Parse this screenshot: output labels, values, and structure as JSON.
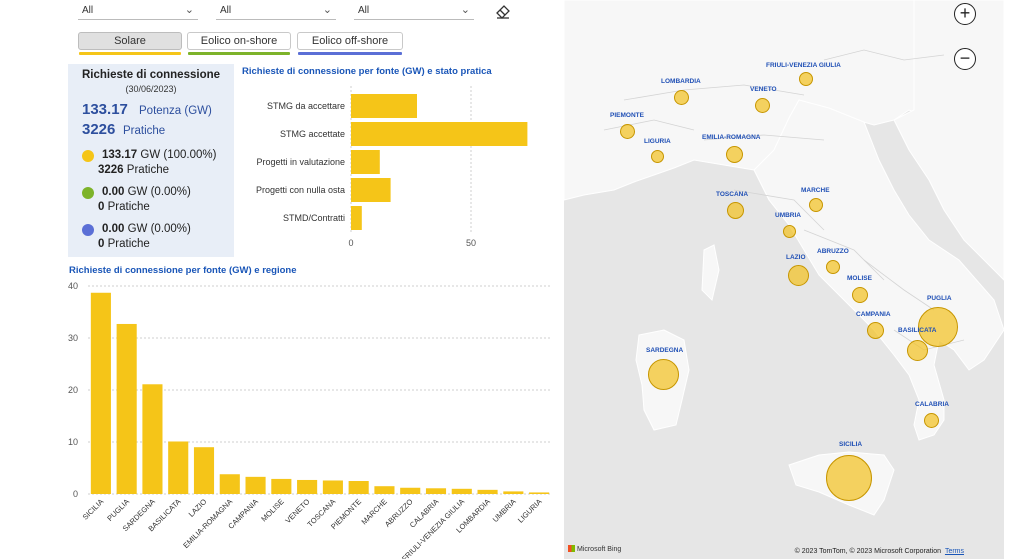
{
  "filters": [
    {
      "value": "All"
    },
    {
      "value": "All"
    },
    {
      "value": "All"
    }
  ],
  "toggles": [
    {
      "label": "Solare",
      "active": true,
      "color": "#f5c518"
    },
    {
      "label": "Eolico on-shore",
      "active": false,
      "color": "#7db32a"
    },
    {
      "label": "Eolico off-shore",
      "active": false,
      "color": "#5b6fd6"
    }
  ],
  "summary": {
    "title": "Richieste di connessione",
    "date": "(30/06/2023)",
    "total_power": "133.17",
    "total_power_label": "Potenza (GW)",
    "total_count": "3226",
    "total_count_label": "Pratiche",
    "sources": [
      {
        "color": "#f5c518",
        "gw": "133.17",
        "gw_label": "GW (100.00%)",
        "count": "3226",
        "count_label": "Pratiche"
      },
      {
        "color": "#7db32a",
        "gw": "0.00",
        "gw_label": "GW (0.00%)",
        "count": "0",
        "count_label": "Pratiche"
      },
      {
        "color": "#5b6fd6",
        "gw": "0.00",
        "gw_label": "GW (0.00%)",
        "count": "0",
        "count_label": "Pratiche"
      }
    ]
  },
  "chart_data": [
    {
      "type": "bar",
      "orientation": "horizontal",
      "title": "Richieste di connessione per fonte (GW) e stato pratica",
      "categories": [
        "STMG da accettare",
        "STMG accettate",
        "Progetti in valutazione",
        "Progetti con nulla osta",
        "STMD/Contratti"
      ],
      "values": [
        27.5,
        73.5,
        12,
        16.5,
        4.5
      ],
      "xticks": [
        0,
        50
      ],
      "xlim": [
        0,
        75
      ],
      "color": "#f5c518",
      "grid": true
    },
    {
      "type": "bar",
      "orientation": "vertical",
      "title": "Richieste di connessione per fonte (GW) e regione",
      "categories": [
        "SICILIA",
        "PUGLIA",
        "SARDEGNA",
        "BASILICATA",
        "LAZIO",
        "EMILIA-ROMAGNA",
        "CAMPANIA",
        "MOLISE",
        "VENETO",
        "TOSCANA",
        "PIEMONTE",
        "MARCHE",
        "ABRUZZO",
        "CALABRIA",
        "FRIULI-VENEZIA GIULIA",
        "LOMBARDIA",
        "UMBRIA",
        "LIGURIA"
      ],
      "values": [
        38.7,
        32.7,
        21.1,
        10.1,
        9.0,
        3.8,
        3.3,
        2.9,
        2.7,
        2.6,
        2.5,
        1.5,
        1.2,
        1.1,
        1.0,
        0.8,
        0.5,
        0.3
      ],
      "yticks": [
        0,
        10,
        20,
        30,
        40
      ],
      "ylim": [
        0,
        40
      ],
      "color": "#f5c518",
      "grid": true
    }
  ],
  "map": {
    "zoom_in": "+",
    "zoom_out": "−",
    "regions": [
      {
        "name": "FRIULI-VENEZIA GIULIA",
        "size": 14
      },
      {
        "name": "LOMBARDIA",
        "size": 15
      },
      {
        "name": "VENETO",
        "size": 15
      },
      {
        "name": "PIEMONTE",
        "size": 15
      },
      {
        "name": "LIGURIA",
        "size": 13
      },
      {
        "name": "EMILIA-ROMAGNA",
        "size": 17
      },
      {
        "name": "TOSCANA",
        "size": 17
      },
      {
        "name": "MARCHE",
        "size": 14
      },
      {
        "name": "UMBRIA",
        "size": 13
      },
      {
        "name": "ABRUZZO",
        "size": 14
      },
      {
        "name": "LAZIO",
        "size": 21
      },
      {
        "name": "MOLISE",
        "size": 16
      },
      {
        "name": "PUGLIA",
        "size": 40
      },
      {
        "name": "CAMPANIA",
        "size": 17
      },
      {
        "name": "BASILICATA",
        "size": 21
      },
      {
        "name": "SARDEGNA",
        "size": 31
      },
      {
        "name": "CALABRIA",
        "size": 15
      },
      {
        "name": "SICILIA",
        "size": 46
      }
    ],
    "logo_text": "Microsoft Bing",
    "attribution": "© 2023 TomTom, © 2023 Microsoft Corporation",
    "terms": "Terms"
  }
}
